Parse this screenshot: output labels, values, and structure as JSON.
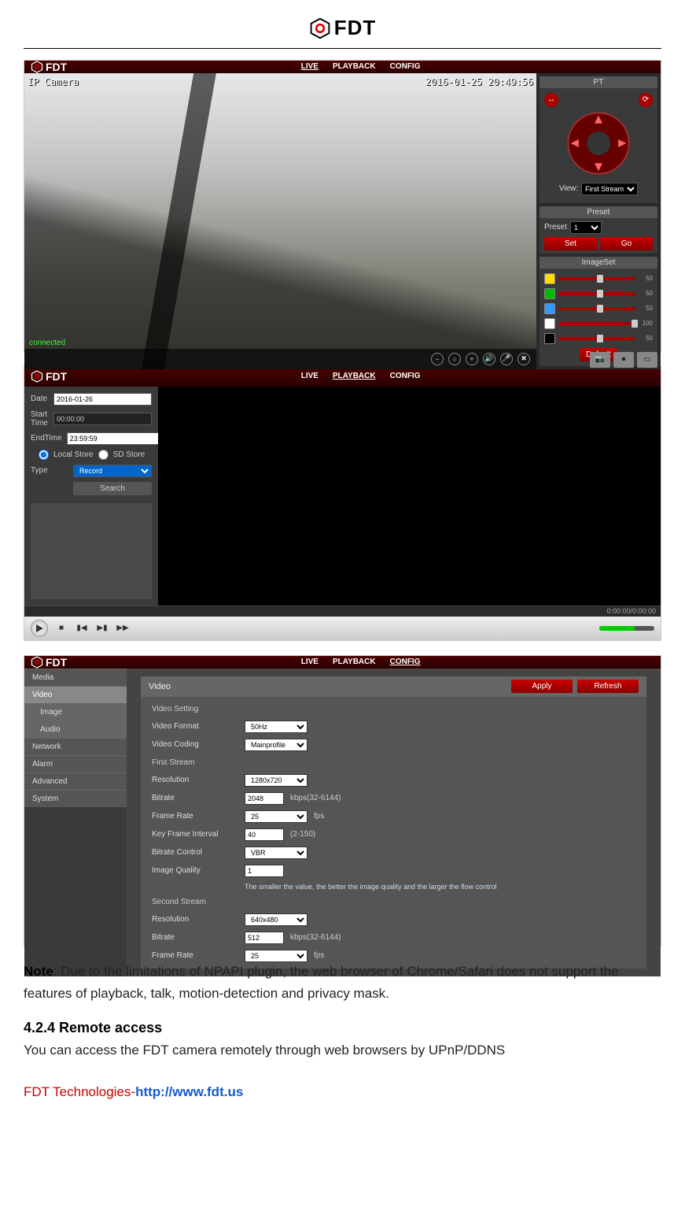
{
  "header_logo_text": "FDT",
  "nav": {
    "live": "LIVE",
    "playback": "PLAYBACK",
    "config": "CONFIG"
  },
  "live": {
    "camera_name": "IP Camera",
    "timestamp": "2016-01-25 20:49:56",
    "connected": "connected",
    "pt_title": "PT",
    "view_label": "View:",
    "view_value": "First Stream",
    "preset_title": "Preset",
    "preset_label": "Preset",
    "preset_value": "1",
    "set_btn": "Set",
    "go_btn": "Go",
    "imageset_title": "ImageSet",
    "sliders": [
      {
        "value": "50",
        "color": "#ffdd00",
        "cls": "s50"
      },
      {
        "value": "50",
        "color": "#00bb00",
        "cls": "s50"
      },
      {
        "value": "50",
        "color": "#3399ff",
        "cls": "s50"
      },
      {
        "value": "100",
        "color": "#ffffff",
        "cls": "s100"
      },
      {
        "value": "50",
        "color": "#000000",
        "cls": "s50"
      }
    ],
    "default_btn": "Default"
  },
  "playback": {
    "date_label": "Date",
    "date_value": "2016-01-26",
    "start_label": "Start Time",
    "start_value": "00:00:00",
    "end_label": "EndTime",
    "end_value": "23:59:59",
    "opt_local": "Local Store",
    "opt_sd": "SD Store",
    "type_label": "Type",
    "type_value": "Record",
    "search_btn": "Search",
    "time_counter": "0:00:00/0:00:00"
  },
  "config": {
    "menu": [
      "Media",
      "Video",
      "Image",
      "Audio",
      "Network",
      "Alarm",
      "Advanced",
      "System"
    ],
    "hdr_title": "Video",
    "apply_btn": "Apply",
    "refresh_btn": "Refresh",
    "sec_video_setting": "Video Setting",
    "rows": {
      "format": {
        "label": "Video Format",
        "value": "50Hz"
      },
      "coding": {
        "label": "Video Coding",
        "value": "Mainprofile"
      }
    },
    "sec_first": "First Stream",
    "first": {
      "resolution": {
        "label": "Resolution",
        "value": "1280x720"
      },
      "bitrate": {
        "label": "Bitrate",
        "value": "2048",
        "suffix": "kbps(32-6144)"
      },
      "frame": {
        "label": "Frame Rate",
        "value": "25",
        "suffix": "fps"
      },
      "keyframe": {
        "label": "Key Frame Interval",
        "value": "40",
        "suffix": "(2-150)"
      },
      "control": {
        "label": "Bitrate Control",
        "value": "VBR"
      },
      "quality": {
        "label": "Image Quality",
        "value": "1"
      },
      "quality_note": "The smaller the value, the better the image quality and the larger the flow control"
    },
    "sec_second": "Second Stream",
    "second": {
      "resolution": {
        "label": "Resolution",
        "value": "640x480"
      },
      "bitrate": {
        "label": "Bitrate",
        "value": "512",
        "suffix": "kbps(32-6144)"
      },
      "frame": {
        "label": "Frame Rate",
        "value": "25",
        "suffix": "fps"
      }
    }
  },
  "doc": {
    "note_label": "Note",
    "note_body": ": Due to the limitations of NPAPI plugin, the web browser of Chrome/Safari does not support the features of playback, talk, motion-detection and privacy mask.",
    "h": "4.2.4 Remote access",
    "p": "You can access the FDT camera remotely through web browsers by UPnP/DDNS",
    "footer_brand": "FDT Technologies-",
    "footer_url": "http://www.fdt.us"
  }
}
